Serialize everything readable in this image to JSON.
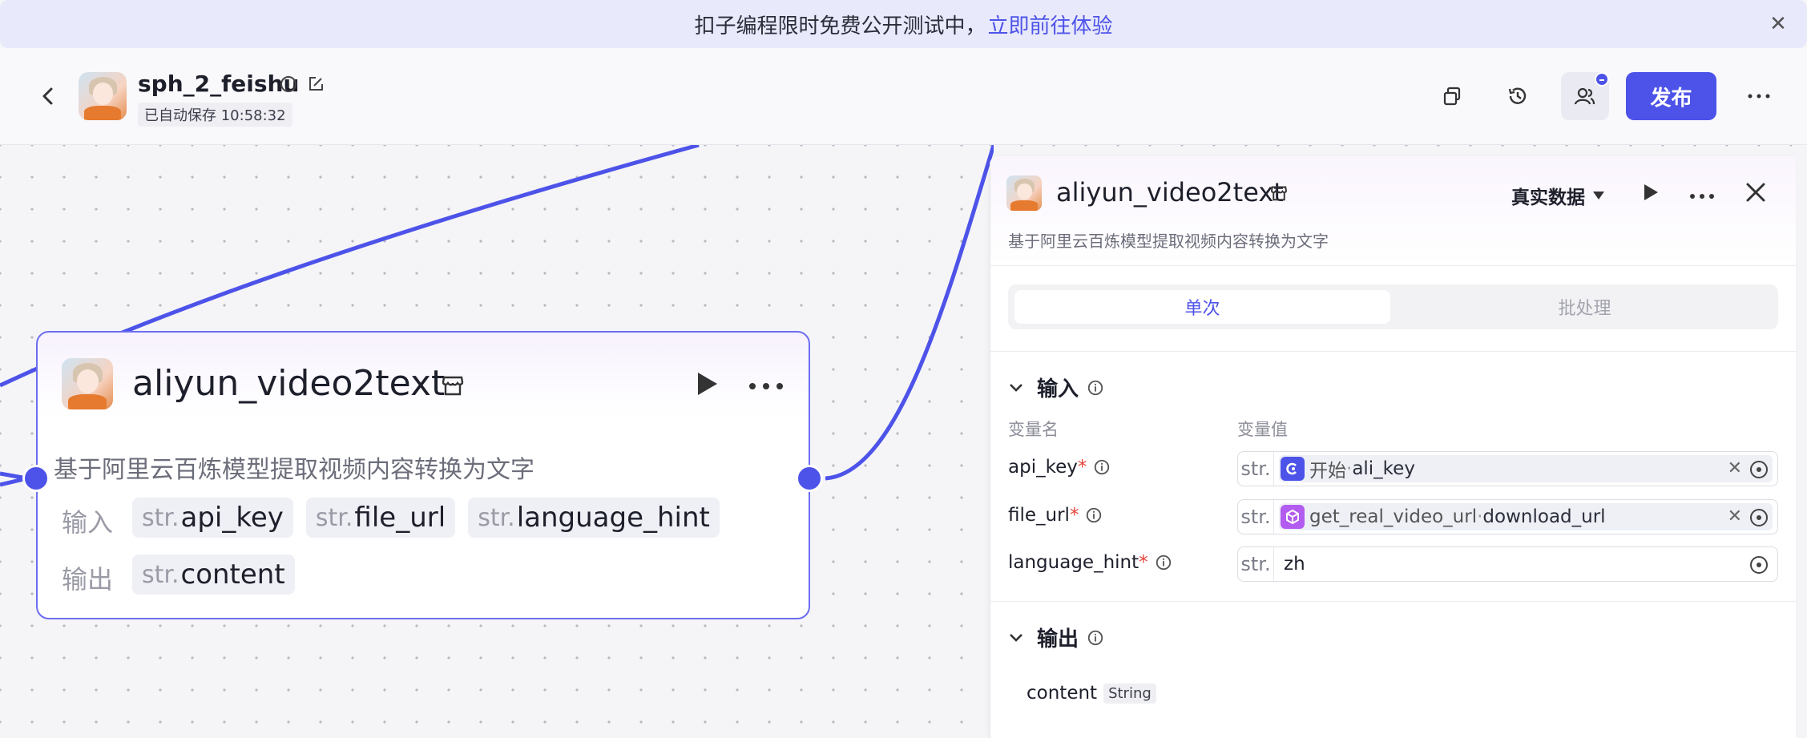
{
  "banner": {
    "text": "扣子编程限时免费公开测试中，",
    "link": "立即前往体验"
  },
  "header": {
    "title": "sph_2_feishu",
    "autosave": "已自动保存 10:58:32",
    "publish": "发布"
  },
  "node": {
    "title": "aliyun_video2text",
    "description": "基于阿里云百炼模型提取视频内容转换为文字",
    "input_label": "输入",
    "output_label": "输出",
    "inputs": [
      {
        "type": "str.",
        "name": "api_key"
      },
      {
        "type": "str.",
        "name": "file_url"
      },
      {
        "type": "str.",
        "name": "language_hint"
      }
    ],
    "outputs": [
      {
        "type": "str.",
        "name": "content"
      }
    ]
  },
  "panel": {
    "title": "aliyun_video2text",
    "data_mode": "真实数据",
    "description": "基于阿里云百炼模型提取视频内容转换为文字",
    "tabs": [
      "单次",
      "批处理"
    ],
    "input_section": "输入",
    "col_name": "变量名",
    "col_value": "变量值",
    "params": [
      {
        "name": "api_key",
        "req": "*",
        "type": "str.",
        "ref_source": "开始",
        "sep": " · ",
        "ref_field": "ali_key"
      },
      {
        "name": "file_url",
        "req": "*",
        "type": "str.",
        "ref_source": "get_real_video_url",
        "sep": " · ",
        "ref_field": "download_url"
      },
      {
        "name": "language_hint",
        "req": "*",
        "type": "str.",
        "value": "zh"
      }
    ],
    "output_section": "输出",
    "outputs": [
      {
        "name": "content",
        "type": "String"
      }
    ]
  },
  "colors": {
    "accent": "#4d53e8",
    "required": "#e5433b",
    "workflow_icon": "#b25cf0"
  }
}
